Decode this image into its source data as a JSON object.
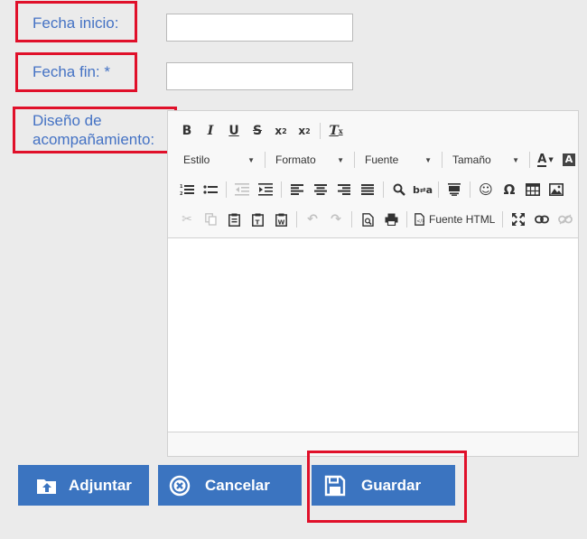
{
  "form": {
    "start_date_label": "Fecha inicio:",
    "start_date_value": "",
    "end_date_label": "Fecha fin: *",
    "end_date_value": "",
    "design_label_line1": "Diseño de",
    "design_label_line2": "acompañamiento:"
  },
  "editor": {
    "row1": [
      "bold-icon",
      "italic-icon",
      "underline-icon",
      "strikethrough-icon",
      "subscript-icon",
      "superscript-icon",
      "remove-format-icon"
    ],
    "dropdowns": {
      "style": "Estilo",
      "format": "Formato",
      "font": "Fuente",
      "size": "Tamaño"
    },
    "source_label": "Fuente HTML",
    "content": ""
  },
  "buttons": {
    "attach": "Adjuntar",
    "cancel": "Cancelar",
    "save": "Guardar"
  },
  "colors": {
    "label": "#4472c4",
    "button": "#3b74c0",
    "highlight": "#e0102a",
    "background": "#ebebeb"
  }
}
